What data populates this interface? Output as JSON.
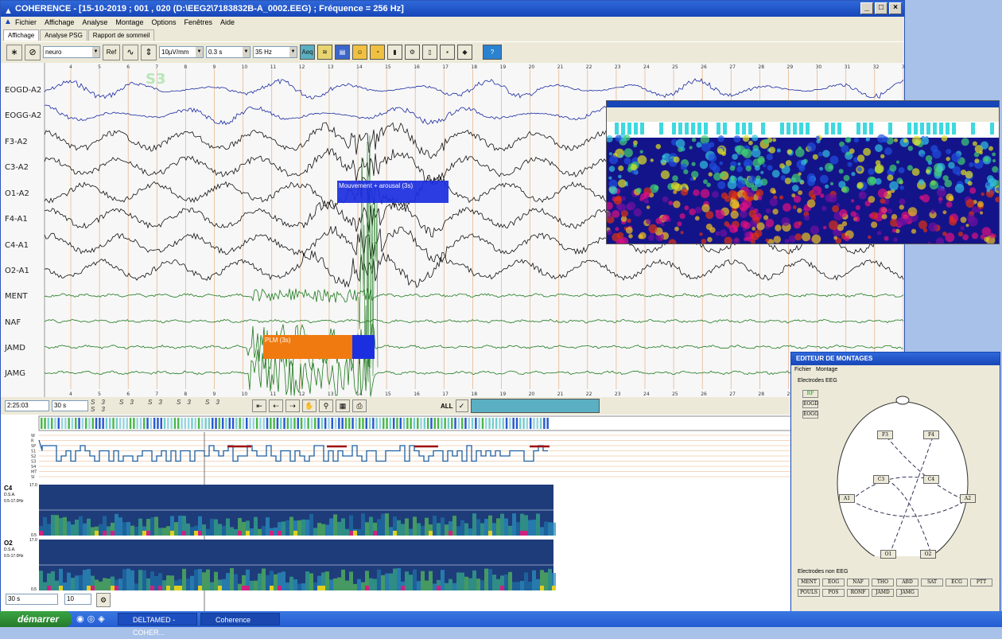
{
  "window": {
    "title": "COHERENCE - [15-10-2019 ; 001 , 020 (D:\\EEG2\\7183832B-A_0002.EEG) ; Fréquence = 256 Hz]"
  },
  "menu": [
    "Fichier",
    "Affichage",
    "Analyse",
    "Montage",
    "Options",
    "Fenêtres",
    "Aide"
  ],
  "tabs": [
    "Affichage",
    "Analyse PSG",
    "Rapport de sommeil"
  ],
  "toolbar": {
    "montage": "neuro",
    "ref_label": "Ref",
    "gain": "10µV/mm",
    "time_const": "0.3 s",
    "filter": "35 Hz",
    "aeq_label": "Aeq"
  },
  "channels": [
    "EOGD-A2",
    "EOGG-A2",
    "F3-A2",
    "C3-A2",
    "O1-A2",
    "F4-A1",
    "C4-A1",
    "O2-A1",
    "MENT",
    "NAF",
    "JAMD",
    "JAMG"
  ],
  "time_ticks_top": [
    "4",
    "5",
    "6",
    "7",
    "8",
    "9",
    "10",
    "11",
    "12",
    "13",
    "14",
    "15",
    "16",
    "17",
    "18",
    "19",
    "20",
    "21",
    "22",
    "23",
    "24",
    "25",
    "26",
    "27",
    "28",
    "29",
    "30",
    "31",
    "32",
    "33"
  ],
  "time_ticks_bottom": [
    "4",
    "5",
    "6",
    "7",
    "8",
    "9",
    "10",
    "11",
    "12",
    "13",
    "14",
    "15",
    "16",
    "17",
    "18",
    "19",
    "20",
    "21",
    "22",
    "23",
    "24",
    "25",
    "26",
    "27",
    "28",
    "29",
    "30",
    "31",
    "32"
  ],
  "stage_label": "S3",
  "events": {
    "arousal": "Mouvement + arousal (3s)",
    "plm": "PLM (3s)"
  },
  "controls": {
    "clock": "2:25:03",
    "epoch": "30 s",
    "all_label": "ALL",
    "bottom_epoch": "30 s",
    "bottom_count": "10"
  },
  "hypnogram": {
    "stages": [
      "W",
      "R",
      "SP",
      "S1",
      "S2",
      "S3",
      "S4",
      "MT",
      "SI"
    ]
  },
  "dsa": [
    {
      "channel": "C4",
      "label1": "D.S.A.",
      "label2": "0.5-17.0Hz",
      "top": "17.0",
      "bottom": "0.5"
    },
    {
      "channel": "O2",
      "label1": "D.S.A.",
      "label2": "0.5-17.0Hz",
      "top": "17.0",
      "bottom": "0.5"
    }
  ],
  "editor": {
    "title": "EDITEUR DE MONTAGES",
    "menu": [
      "Fichier",
      "Montage"
    ],
    "electrodes_label": "Electrodes EEG",
    "ref_buttons": [
      "RF",
      "EOGD",
      "EOGG"
    ],
    "electrodes": [
      "F3",
      "F4",
      "C3",
      "C4",
      "A1",
      "A2",
      "O1",
      "O2"
    ],
    "selection_label": "Electrodes non EEG",
    "selection_buttons": [
      "MENT",
      "EOG",
      "NAF",
      "THO",
      "ABD",
      "SAT",
      "ECG",
      "PTT",
      "POULS",
      "POS",
      "RONF",
      "JAMD",
      "JAMG"
    ]
  },
  "taskbar": {
    "start": "démarrer",
    "items": [
      "DELTAMED - COHER...",
      "Coherence"
    ]
  },
  "colors": {
    "eog": "#1a2aa0",
    "eeg": "#111111",
    "emg": "#1d7a1d",
    "event_blue": "#1b2fe0",
    "event_orange": "#f07a10",
    "accent": "#1746b8"
  }
}
